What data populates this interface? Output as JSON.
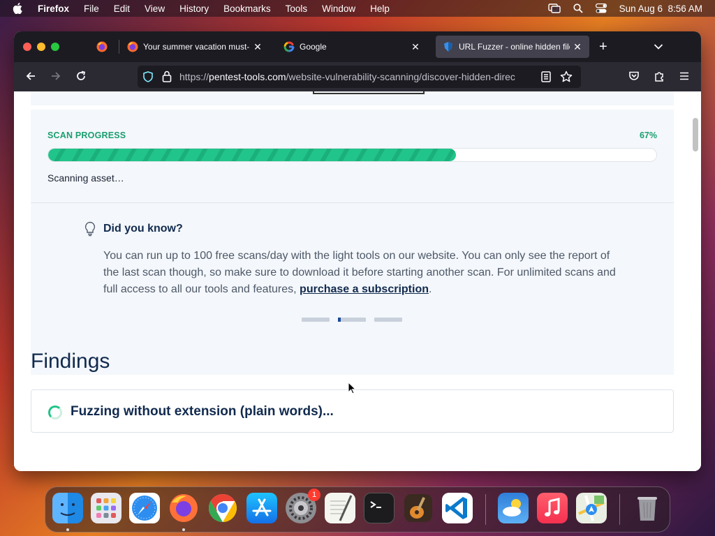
{
  "menubar": {
    "app": "Firefox",
    "items": [
      "File",
      "Edit",
      "View",
      "History",
      "Bookmarks",
      "Tools",
      "Window",
      "Help"
    ],
    "clock": "Sun Aug 6  8:56 AM"
  },
  "tabs": [
    {
      "title": "Your summer vacation must-have",
      "icon": "firefox-icon"
    },
    {
      "title": "Google",
      "icon": "google-icon"
    },
    {
      "title": "URL Fuzzer - online hidden file &",
      "icon": "pentest-tools-icon",
      "active": true
    }
  ],
  "address": {
    "prefix": "https://",
    "domain": "pentest-tools.com",
    "path": "/website-vulnerability-scanning/discover-hidden-direc"
  },
  "scan": {
    "label": "SCAN PROGRESS",
    "percent_text": "67%",
    "progress": 0.67,
    "status": "Scanning asset…"
  },
  "tip": {
    "title": "Did you know?",
    "body_before": "You can run up to 100 free scans/day with the light tools on our website. You can only see the report of the last scan though, so make sure to download it before starting another scan. For unlimited scans and full access to all our tools and features, ",
    "link": "purchase a subscription",
    "body_after": "."
  },
  "findings": {
    "title": "Findings",
    "items": [
      {
        "text": "Fuzzing without extension (plain words)..."
      }
    ]
  },
  "dock": {
    "apps": [
      "finder-icon",
      "launchpad-icon",
      "safari-icon",
      "firefox-icon",
      "chrome-icon",
      "app-store-icon",
      "system-settings-icon",
      "textedit-icon",
      "terminal-icon",
      "garageband-icon",
      "vscode-icon",
      "weather-icon",
      "music-icon",
      "maps-icon",
      "trash-icon"
    ],
    "settings_badge": "1"
  },
  "colors": {
    "accent_green": "#21c48a",
    "navy": "#112a4e"
  }
}
